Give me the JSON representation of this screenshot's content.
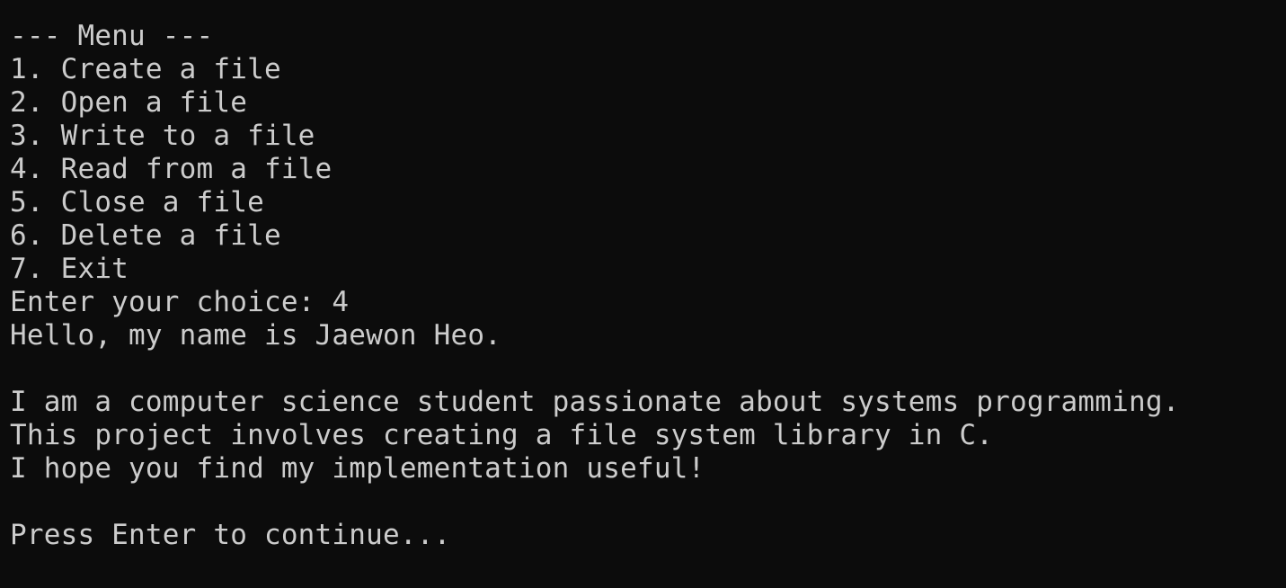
{
  "terminal": {
    "colors": {
      "background": "#0c0c0c",
      "foreground": "#cccccc"
    },
    "menu": {
      "header": "--- Menu ---",
      "items": [
        "1. Create a file",
        "2. Open a file",
        "3. Write to a file",
        "4. Read from a file",
        "5. Close a file",
        "6. Delete a file",
        "7. Exit"
      ]
    },
    "prompt": "Enter your choice: 4",
    "file_content": {
      "greeting": "Hello, my name is Jaewon Heo.",
      "paragraph": [
        "I am a computer science student passionate about systems programming.",
        "This project involves creating a file system library in C.",
        "I hope you find my implementation useful!"
      ]
    },
    "continue_prompt": "Press Enter to continue..."
  }
}
